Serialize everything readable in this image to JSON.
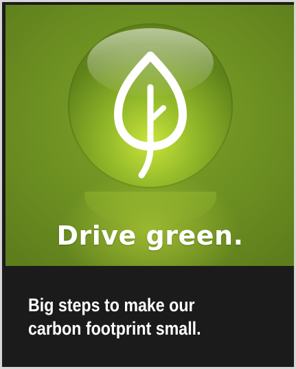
{
  "banner": {
    "headline": "Drive green.",
    "tagline_line1": "Big steps to make our",
    "tagline_line2": "carbon footprint small.",
    "icon": "leaf-icon",
    "colors": {
      "panel_green": "#6d9022",
      "orb_highlight": "#c8e23c",
      "dark_band": "#1b1b1b",
      "text": "#ffffff"
    }
  }
}
